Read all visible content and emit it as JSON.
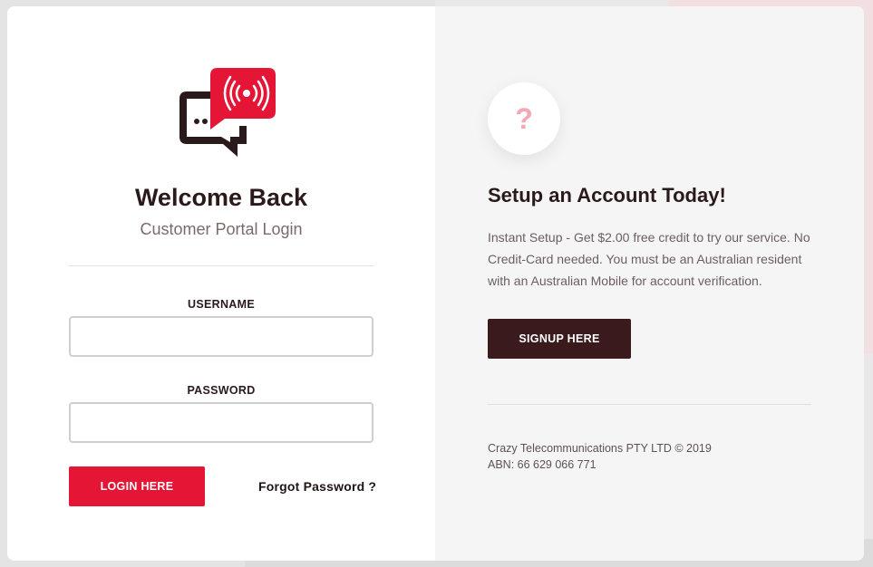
{
  "login": {
    "title": "Welcome Back",
    "subtitle": "Customer Portal Login",
    "username_label": "USERNAME",
    "username_value": "",
    "password_label": "PASSWORD",
    "password_value": "",
    "login_button": "LOGIN HERE",
    "forgot_link": "Forgot Password ?",
    "logo_icon": "chat-broadcast-icon"
  },
  "signup": {
    "icon_glyph": "?",
    "title": "Setup an Account Today!",
    "description": "Instant Setup - Get $2.00 free credit to try our service. No Credit-Card needed. You must be an Australian resident with an Australian Mobile for account verification.",
    "button": "SIGNUP HERE",
    "company": "Crazy Telecommunications PTY LTD © 2019",
    "abn": "ABN: 66 629 066 771"
  },
  "colors": {
    "accent_red": "#e41535",
    "dark_maroon": "#3a1a1d",
    "heading": "#2b1a1b",
    "question_pink": "#f4a7b4"
  }
}
